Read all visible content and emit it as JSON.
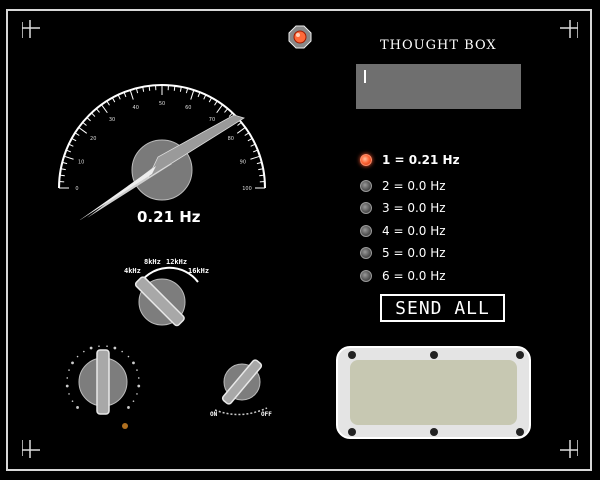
{
  "app": {
    "title": "THOUGHT BOX",
    "thought_input": ""
  },
  "frequency_meter": {
    "readout": "0.21 Hz",
    "scale_labels": [
      "0",
      "10",
      "20",
      "30",
      "40",
      "50",
      "60",
      "70",
      "80",
      "90",
      "100"
    ],
    "needle_value": 0.21
  },
  "range_selector": {
    "labels": [
      "4kHz",
      "8kHz",
      "12kHz",
      "16kHz"
    ]
  },
  "power_switch": {
    "labels": [
      "ON",
      "OFF"
    ]
  },
  "channels": [
    {
      "label": "1 = 0.21 Hz",
      "active": true
    },
    {
      "label": "2 = 0.0 Hz",
      "active": false
    },
    {
      "label": "3 = 0.0 Hz",
      "active": false
    },
    {
      "label": "4 = 0.0 Hz",
      "active": false
    },
    {
      "label": "5 = 0.0 Hz",
      "active": false
    },
    {
      "label": "6 = 0.0 Hz",
      "active": false
    }
  ],
  "send_all_label": "SEND ALL",
  "colors": {
    "panel": "#000000",
    "led_on": "#ff6a3a",
    "thought_box": "#6f6f6f",
    "screen": "#c7c8b2"
  }
}
